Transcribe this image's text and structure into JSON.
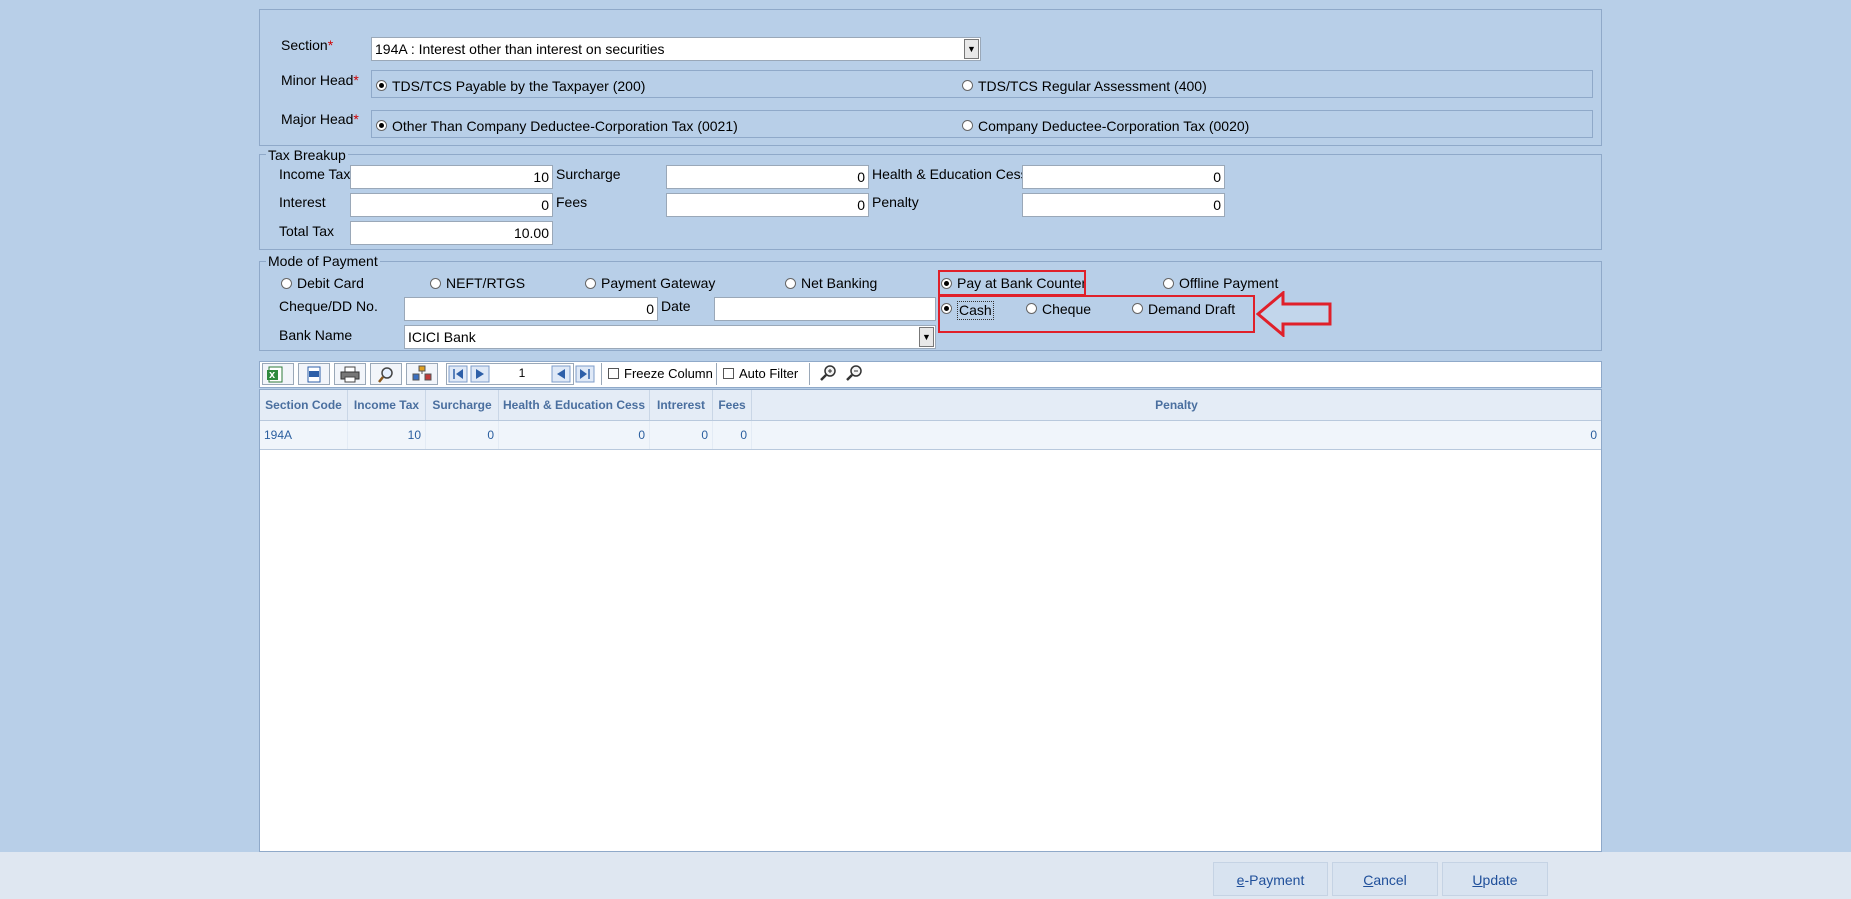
{
  "section": {
    "label": "Section",
    "required_mark": "*",
    "value": "194A : Interest other than interest on securities"
  },
  "minor_head": {
    "label": "Minor Head",
    "required_mark": "*",
    "options": [
      "TDS/TCS Payable by the Taxpayer (200)",
      "TDS/TCS Regular Assessment (400)"
    ],
    "selected": "TDS/TCS Payable by the Taxpayer (200)"
  },
  "major_head": {
    "label": "Major Head",
    "required_mark": "*",
    "options": [
      "Other Than Company Deductee-Corporation Tax (0021)",
      "Company Deductee-Corporation Tax (0020)"
    ],
    "selected": "Other Than Company Deductee-Corporation Tax (0021)"
  },
  "tax_breakup": {
    "legend": "Tax Breakup",
    "income_tax_label": "Income Tax",
    "income_tax": "10",
    "surcharge_label": "Surcharge",
    "surcharge": "0",
    "cess_label": "Health & Education Cess",
    "cess": "0",
    "interest_label": "Interest",
    "interest": "0",
    "fees_label": "Fees",
    "fees": "0",
    "penalty_label": "Penalty",
    "penalty": "0",
    "total_tax_label": "Total Tax",
    "total_tax": "10.00"
  },
  "payment": {
    "legend": "Mode of Payment",
    "modes": [
      "Debit Card",
      "NEFT/RTGS",
      "Payment Gateway",
      "Net Banking",
      "Pay at Bank Counter",
      "Offline Payment"
    ],
    "selected_mode": "Pay at Bank Counter",
    "instruments": [
      "Cash",
      "Cheque",
      "Demand Draft"
    ],
    "selected_instrument": "Cash",
    "cheque_label": "Cheque/DD No.",
    "cheque_value": "0",
    "date_label": "Date",
    "date_value": "",
    "bank_label": "Bank Name",
    "bank_value": "ICICI Bank"
  },
  "toolbar": {
    "page_number": "1",
    "freeze_column": "Freeze Column",
    "auto_filter": "Auto Filter",
    "icons": [
      "excel-export-icon",
      "csv-export-icon",
      "print-icon",
      "preview-icon",
      "column-chooser-icon",
      "first-page-icon",
      "prev-page-icon",
      "prev-icon",
      "last-page-icon",
      "zoom-in-icon",
      "zoom-out-icon"
    ]
  },
  "grid": {
    "columns": [
      "Section Code",
      "Income Tax",
      "Surcharge",
      "Health & Education Cess",
      "Intrerest",
      "Fees",
      "Penalty"
    ],
    "rows": [
      [
        "194A",
        "10",
        "0",
        "0",
        "0",
        "0",
        "0"
      ]
    ]
  },
  "footer": {
    "epayment_hotkey": "e",
    "epayment_rest": "-Payment",
    "cancel_hotkey": "C",
    "cancel_rest": "ancel",
    "update_hotkey": "U",
    "update_rest": "pdate"
  },
  "colors": {
    "background": "#b8cfe8",
    "highlight": "#e0202a",
    "grid_header_text": "#4a6f9f",
    "footer_bar": "#dfe7f1"
  }
}
